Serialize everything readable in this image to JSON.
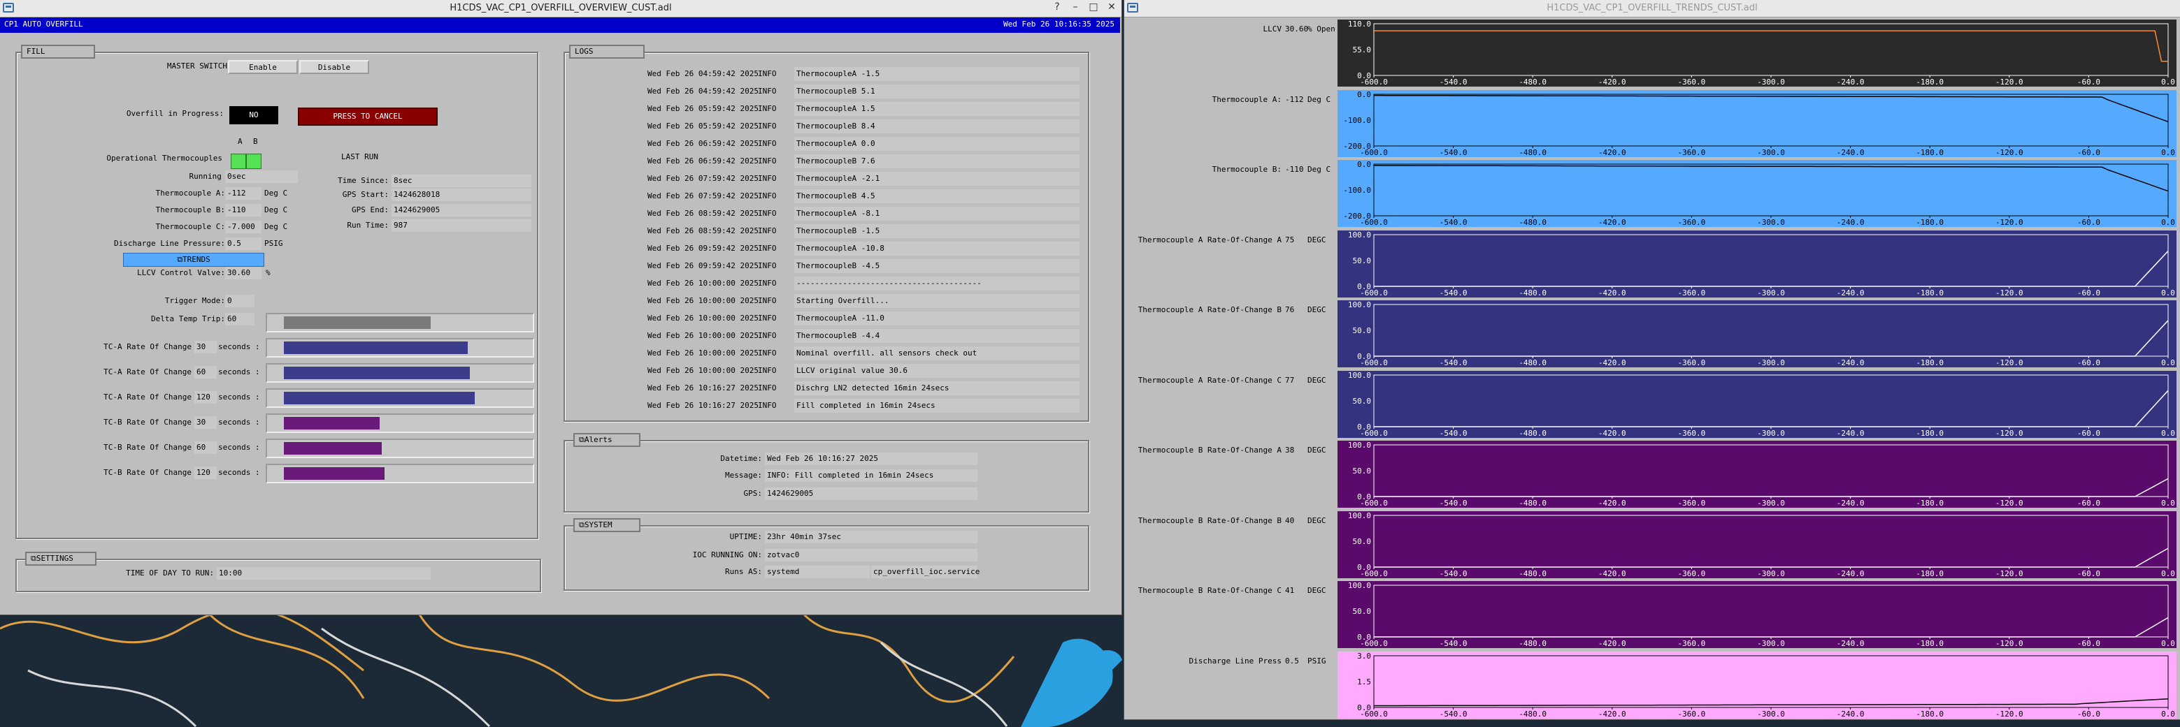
{
  "overview_window": {
    "title": "H1CDS_VAC_CP1_OVERFILL_OVERVIEW_CUST.adl",
    "header_title": "CP1 AUTO OVERFILL",
    "header_time": "Wed Feb 26 10:16:35 2025",
    "fill": {
      "section_label": "FILL",
      "master_switch_label": "MASTER SWITCH",
      "enable_label": "Enable",
      "disable_label": "Disable",
      "overfill_label": "Overfill in Progress:",
      "overfill_value": "NO",
      "cancel_label": "PRESS TO CANCEL",
      "col_a": "A",
      "col_b": "B",
      "op_tc_label": "Operational Thermocouples",
      "last_run_label": "LAST RUN",
      "left_rows": [
        {
          "label": "Running For:",
          "value": "0sec",
          "unit": ""
        },
        {
          "label": "Thermocouple A:",
          "value": "-112",
          "unit": "Deg C"
        },
        {
          "label": "Thermocouple B:",
          "value": "-110",
          "unit": "Deg C"
        },
        {
          "label": "Thermocouple C:",
          "value": "-7.000",
          "unit": "Deg C"
        },
        {
          "label": "Discharge Line Pressure:",
          "value": "0.5",
          "unit": "PSIG"
        }
      ],
      "right_rows": [
        {
          "label": "Time Since:",
          "value": "8sec"
        },
        {
          "label": "GPS Start:",
          "value": "1424628018"
        },
        {
          "label": "GPS End:",
          "value": "1424629005"
        },
        {
          "label": "Run Time:",
          "value": "987"
        }
      ],
      "trends_button": "⧉TRENDS",
      "llcv_label": "LLCV Control Valve:",
      "llcv_value": "30.60",
      "llcv_unit": "%",
      "trigger_label": "Trigger Mode:",
      "trigger_value": "0",
      "delta_label": "Delta Temp Trip:",
      "delta_value": "60",
      "rate_rows": [
        {
          "label": "TC-A Rate Of Change",
          "value": "30",
          "unit": "seconds :"
        },
        {
          "label": "TC-A Rate Of Change",
          "value": "60",
          "unit": "seconds :"
        },
        {
          "label": "TC-A Rate Of Change",
          "value": "120",
          "unit": "seconds :"
        },
        {
          "label": "TC-B Rate Of Change",
          "value": "30",
          "unit": "seconds :"
        },
        {
          "label": "TC-B Rate Of Change",
          "value": "60",
          "unit": "seconds :"
        },
        {
          "label": "TC-B Rate Of Change",
          "value": "120",
          "unit": "seconds :"
        }
      ],
      "bar_levels": [
        0.6,
        0.75,
        0.76,
        0.78,
        0.39,
        0.4,
        0.41
      ],
      "bar_colors": [
        "#7a7a7a",
        "#3c3c8c",
        "#3c3c8c",
        "#3c3c8c",
        "#6a1a7a",
        "#6a1a7a",
        "#6a1a7a"
      ]
    },
    "settings": {
      "section_label": "⧉SETTINGS",
      "time_label": "TIME OF DAY TO RUN:",
      "time_value": "10:00"
    },
    "logs": {
      "section_label": "LOGS",
      "entries": [
        {
          "time": "Wed Feb 26 04:59:42 2025",
          "level": "INFO",
          "msg": "ThermocoupleA -1.5"
        },
        {
          "time": "Wed Feb 26 04:59:42 2025",
          "level": "INFO",
          "msg": "ThermocoupleB 5.1"
        },
        {
          "time": "Wed Feb 26 05:59:42 2025",
          "level": "INFO",
          "msg": "ThermocoupleA 1.5"
        },
        {
          "time": "Wed Feb 26 05:59:42 2025",
          "level": "INFO",
          "msg": "ThermocoupleB 8.4"
        },
        {
          "time": "Wed Feb 26 06:59:42 2025",
          "level": "INFO",
          "msg": "ThermocoupleA 0.0"
        },
        {
          "time": "Wed Feb 26 06:59:42 2025",
          "level": "INFO",
          "msg": "ThermocoupleB 7.6"
        },
        {
          "time": "Wed Feb 26 07:59:42 2025",
          "level": "INFO",
          "msg": "ThermocoupleA -2.1"
        },
        {
          "time": "Wed Feb 26 07:59:42 2025",
          "level": "INFO",
          "msg": "ThermocoupleB 4.5"
        },
        {
          "time": "Wed Feb 26 08:59:42 2025",
          "level": "INFO",
          "msg": "ThermocoupleA -8.1"
        },
        {
          "time": "Wed Feb 26 08:59:42 2025",
          "level": "INFO",
          "msg": "ThermocoupleB -1.5"
        },
        {
          "time": "Wed Feb 26 09:59:42 2025",
          "level": "INFO",
          "msg": "ThermocoupleA -10.8"
        },
        {
          "time": "Wed Feb 26 09:59:42 2025",
          "level": "INFO",
          "msg": "ThermocoupleB -4.5"
        },
        {
          "time": "Wed Feb 26 10:00:00 2025",
          "level": "INFO",
          "msg": "----------------------------------------"
        },
        {
          "time": "Wed Feb 26 10:00:00 2025",
          "level": "INFO",
          "msg": "Starting Overfill..."
        },
        {
          "time": "Wed Feb 26 10:00:00 2025",
          "level": "INFO",
          "msg": "ThermocoupleA -11.0"
        },
        {
          "time": "Wed Feb 26 10:00:00 2025",
          "level": "INFO",
          "msg": "ThermocoupleB -4.4"
        },
        {
          "time": "Wed Feb 26 10:00:00 2025",
          "level": "INFO",
          "msg": "Nominal overfill. all sensors check out"
        },
        {
          "time": "Wed Feb 26 10:00:00 2025",
          "level": "INFO",
          "msg": "LLCV original value 30.6"
        },
        {
          "time": "Wed Feb 26 10:16:27 2025",
          "level": "INFO",
          "msg": "Dischrg LN2 detected 16min 24secs"
        },
        {
          "time": "Wed Feb 26 10:16:27 2025",
          "level": "INFO",
          "msg": "Fill completed in 16min 24secs"
        }
      ]
    },
    "alerts": {
      "section_label": "⧉Alerts",
      "datetime_label": "Datetime:",
      "datetime_value": "Wed Feb 26 10:16:27 2025",
      "message_label": "Message:",
      "message_value": "INFO: Fill completed in 16min 24secs",
      "gps_label": "GPS:",
      "gps_value": "1424629005"
    },
    "system": {
      "section_label": "⧉SYSTEM",
      "uptime_label": "UPTIME:",
      "uptime_value": "23hr 40min 37sec",
      "ioc_label": "IOC RUNNING ON:",
      "ioc_value": "zotvac0",
      "runs_label": "Runs AS:",
      "runs_value": "systemd",
      "runs_service": "cp_overfill_ioc.service"
    }
  },
  "trends_window": {
    "title": "H1CDS_VAC_CP1_OVERFILL_TRENDS_CUST.adl",
    "x_ticks": [
      "-600.0",
      "-540.0",
      "-480.0",
      "-420.0",
      "-360.0",
      "-300.0",
      "-240.0",
      "-180.0",
      "-120.0",
      "-60.0",
      "0.0"
    ],
    "charts": [
      {
        "label": "LLCV",
        "value": "30.60",
        "unit": "% Open",
        "bg": "#2a2a2a",
        "line": "#ff8a30",
        "text": "#ffffff",
        "y_ticks": [
          "110.0",
          "55.0",
          "0.0"
        ],
        "ylim": [
          0,
          110
        ],
        "shape": "flat",
        "level": 95
      },
      {
        "label": "Thermocouple A:",
        "value": "-112",
        "unit": "Deg C",
        "bg": "#55aaff",
        "line": "#000000",
        "text": "#000000",
        "y_ticks": [
          "0.0",
          "-100.0",
          "-200.0"
        ],
        "ylim": [
          -220,
          10
        ],
        "shape": "tc",
        "level": 5,
        "end": -112
      },
      {
        "label": "Thermocouple B:",
        "value": "-110",
        "unit": "Deg C",
        "bg": "#55aaff",
        "line": "#000000",
        "text": "#000000",
        "y_ticks": [
          "0.0",
          "-100.0",
          "-200.0"
        ],
        "ylim": [
          -220,
          10
        ],
        "shape": "tc",
        "level": 4,
        "end": -110
      },
      {
        "label": "Thermocouple A Rate-Of-Change A",
        "value": "75",
        "unit": "DEGC",
        "bg": "#333380",
        "line": "#ffffff",
        "text": "#ffffff",
        "y_ticks": [
          "100.0",
          "50.0",
          "0.0"
        ],
        "ylim": [
          0,
          110
        ],
        "shape": "rise",
        "level": 0,
        "end": 75
      },
      {
        "label": "Thermocouple A Rate-Of-Change B",
        "value": "76",
        "unit": "DEGC",
        "bg": "#333380",
        "line": "#ffffff",
        "text": "#ffffff",
        "y_ticks": [
          "100.0",
          "50.0",
          "0.0"
        ],
        "ylim": [
          0,
          110
        ],
        "shape": "rise",
        "level": 0,
        "end": 76
      },
      {
        "label": "Thermocouple A Rate-Of-Change C",
        "value": "77",
        "unit": "DEGC",
        "bg": "#333380",
        "line": "#ffffff",
        "text": "#ffffff",
        "y_ticks": [
          "100.0",
          "50.0",
          "0.0"
        ],
        "ylim": [
          0,
          110
        ],
        "shape": "rise",
        "level": 0,
        "end": 77
      },
      {
        "label": "Thermocouple B Rate-Of-Change A",
        "value": "38",
        "unit": "DEGC",
        "bg": "#5a0a6a",
        "line": "#ffffff",
        "text": "#ffffff",
        "y_ticks": [
          "100.0",
          "50.0",
          "0.0"
        ],
        "ylim": [
          0,
          110
        ],
        "shape": "rise",
        "level": 0,
        "end": 38
      },
      {
        "label": "Thermocouple B Rate-Of-Change B",
        "value": "40",
        "unit": "DEGC",
        "bg": "#5a0a6a",
        "line": "#ffffff",
        "text": "#ffffff",
        "y_ticks": [
          "100.0",
          "50.0",
          "0.0"
        ],
        "ylim": [
          0,
          110
        ],
        "shape": "rise",
        "level": 0,
        "end": 40
      },
      {
        "label": "Thermocouple B Rate-Of-Change C",
        "value": "41",
        "unit": "DEGC",
        "bg": "#5a0a6a",
        "line": "#ffffff",
        "text": "#ffffff",
        "y_ticks": [
          "100.0",
          "50.0",
          "0.0"
        ],
        "ylim": [
          0,
          110
        ],
        "shape": "rise",
        "level": 0,
        "end": 41
      },
      {
        "label": "Discharge Line Press",
        "value": "0.5",
        "unit": "PSIG",
        "bg": "#ffaaff",
        "line": "#000000",
        "text": "#000000",
        "y_ticks": [
          "3.0",
          "1.5",
          "0.0"
        ],
        "ylim": [
          0,
          3
        ],
        "shape": "press",
        "level": 0.1,
        "end": 0.5
      }
    ]
  }
}
